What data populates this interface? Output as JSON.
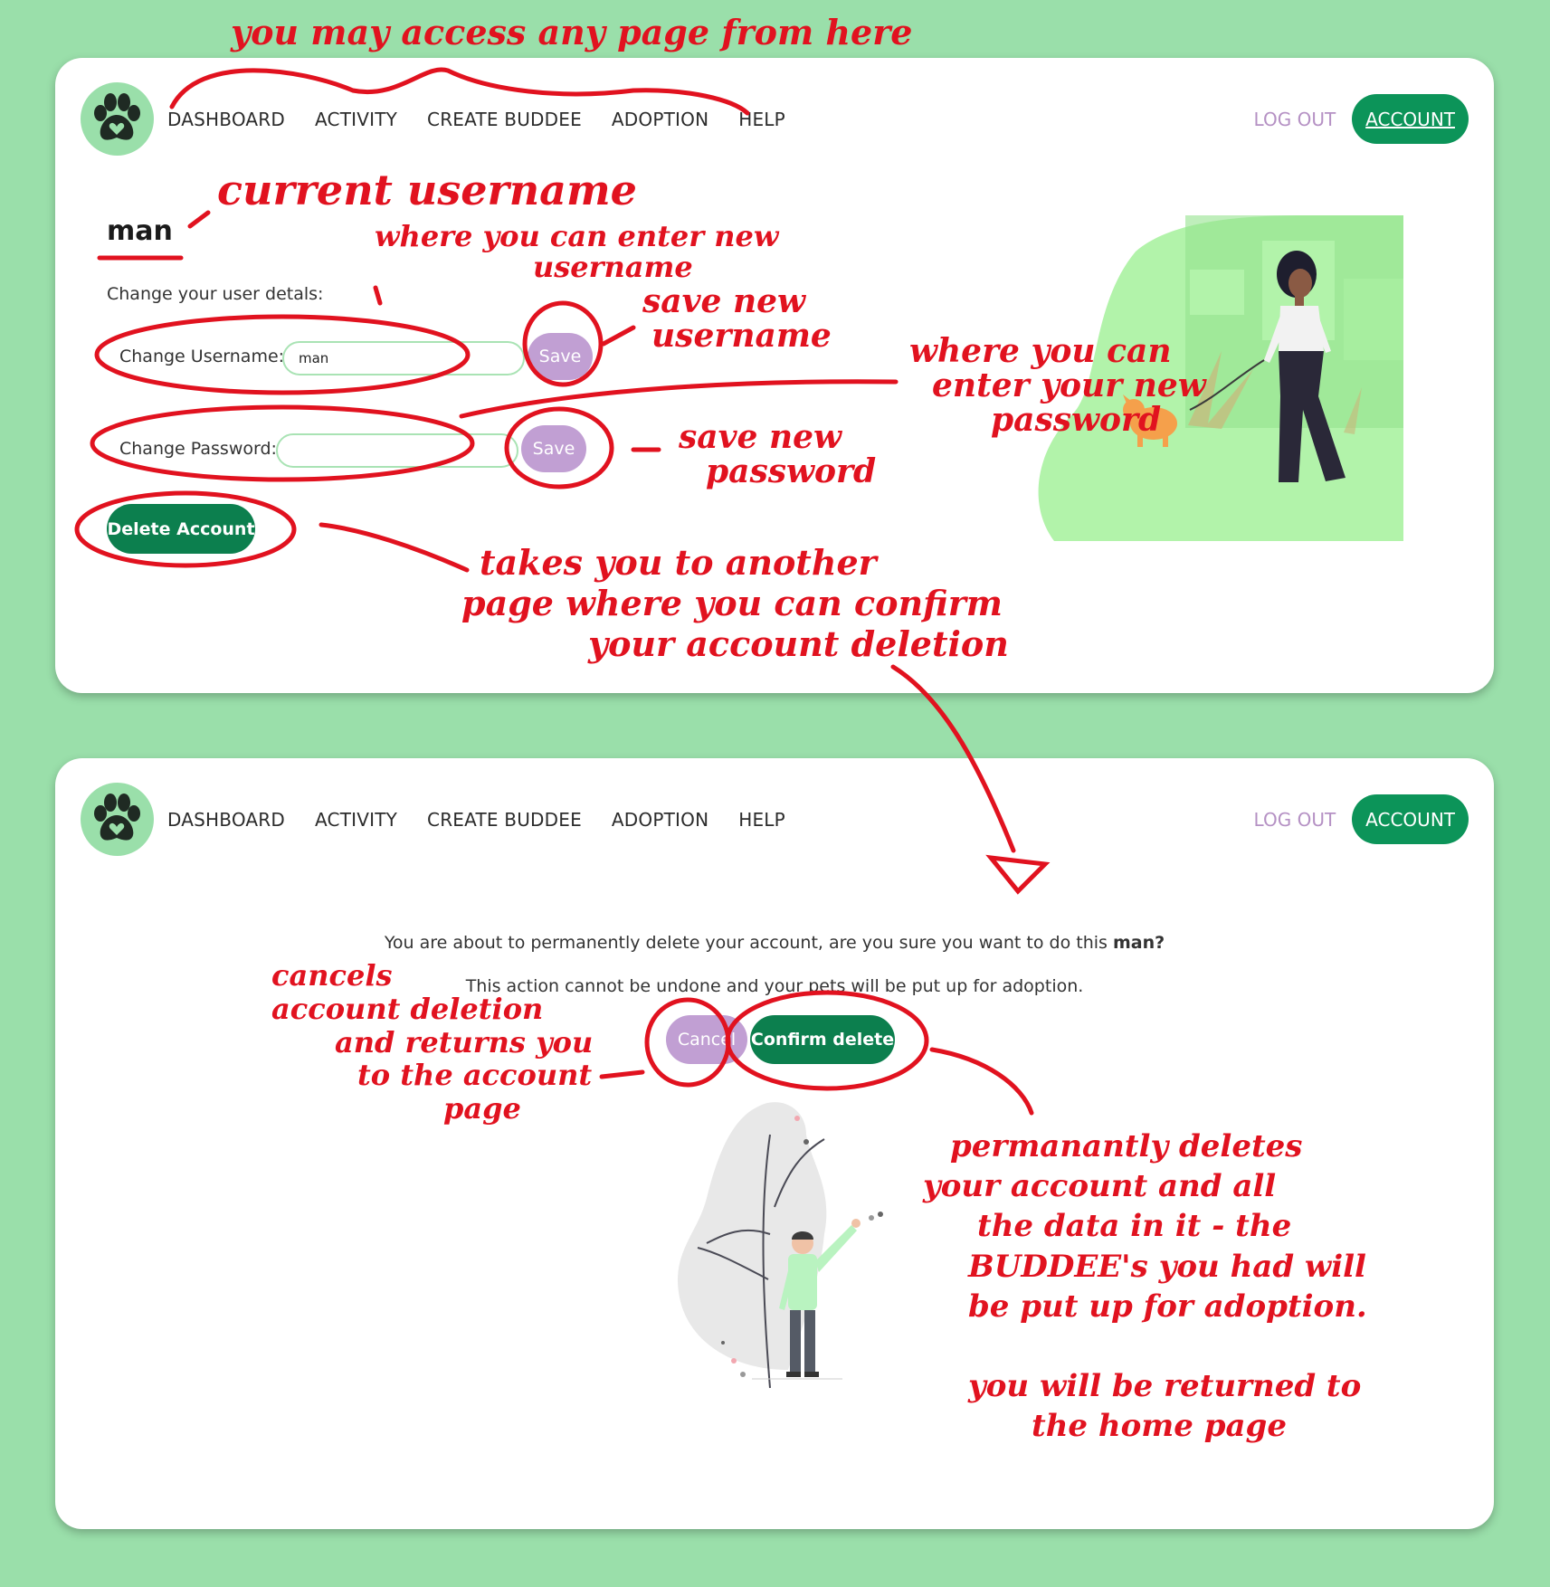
{
  "colors": {
    "background": "#9adfaa",
    "primary_green": "#0c9459",
    "dark_green": "#0c7f4e",
    "lilac": "#c19fd3",
    "logout_text": "#b591c4",
    "annotation_red": "#e1121f"
  },
  "nav": {
    "logo_icon": "paw-heart-icon",
    "links": [
      "DASHBOARD",
      "ACTIVITY",
      "CREATE BUDDEE",
      "ADOPTION",
      "HELP"
    ],
    "logout": "LOG OUT",
    "account": "ACCOUNT"
  },
  "account_page": {
    "username": "man",
    "subtitle": "Change your user detals:",
    "username_label": "Change Username:",
    "username_value": "man",
    "password_label": "Change Password:",
    "password_value": "",
    "save_label": "Save",
    "delete_label": "Delete Account"
  },
  "delete_page": {
    "question_prefix": "You are about to permanently delete your account, are you sure you want to do this ",
    "question_username": "man?",
    "warning": "This action cannot be undone and your pets will be put up for adoption.",
    "cancel_label": "Cancel",
    "confirm_label": "Confirm delete"
  },
  "annotations": {
    "top": "you may access any page from here",
    "current_username": "current username",
    "enter_username": [
      "where you can enter new",
      "username"
    ],
    "save_username": [
      "save new",
      "username"
    ],
    "enter_password": [
      "where you can",
      "enter your new",
      "password"
    ],
    "save_password": [
      "save new",
      "password"
    ],
    "delete_note": [
      "takes you to another",
      "page where you can confirm",
      "your account deletion"
    ],
    "cancel_note": [
      "cancels",
      "account deletion",
      "and returns you",
      "to the account",
      "page"
    ],
    "confirm_note": [
      "permanantly deletes",
      "your account and all",
      "the data in it - the",
      "BUDDEE's you had will",
      "be put up for adoption.",
      "",
      "you will be returned to",
      "the home page"
    ]
  }
}
